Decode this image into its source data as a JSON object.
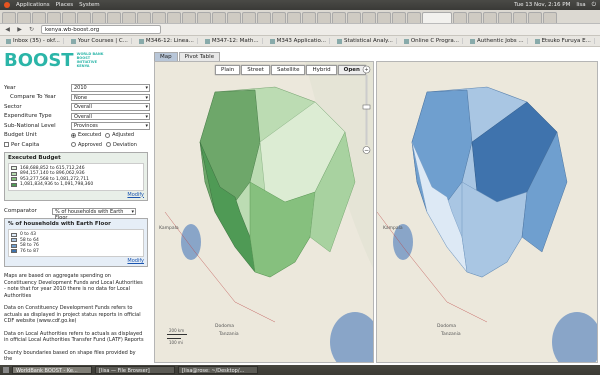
{
  "system_bar": {
    "menu": [
      "Applications",
      "Places",
      "System"
    ],
    "clock": "Tue 13 Nov, 2:16 PM",
    "user": "lisa"
  },
  "browser": {
    "url": "kenya.wb-boost.org",
    "bookmarks": [
      "Inbox (35) - okf...",
      "Your Courses | C...",
      "M346-12: Linea...",
      "M347-12: Math...",
      "M343 Applicatio...",
      "Statistical Analy...",
      "Online C Progra...",
      "Authentic Jobs ...",
      "Etsuko Furuya E..."
    ]
  },
  "logo": {
    "text": "BOOST",
    "tagline": "WORLD BANK BOOST INITIATIVE KENYA"
  },
  "filters": [
    {
      "label": "Year",
      "value": "2010"
    },
    {
      "label": "Compare To Year",
      "value": "None"
    },
    {
      "label": "Sector",
      "value": "Overall"
    },
    {
      "label": "Expenditure Type",
      "value": "Overall"
    },
    {
      "label": "Sub-National Level",
      "value": "Provinces"
    }
  ],
  "budget_unit": {
    "label": "Budget Unit",
    "options": [
      "Executed",
      "Adjusted"
    ],
    "per_capita": "Per Capita",
    "options2": [
      "Approved",
      "Deviation"
    ]
  },
  "executed_budget": {
    "title": "Executed Budget",
    "ranges": [
      "168,688,852 to 615,712,246",
      "894,157,140 to 896,062,936",
      "953,277,568 to 1,081,272,711",
      "1,081,834,936 to 1,091,798,360"
    ],
    "colors": [
      "#e4f1e0",
      "#b7dbb0",
      "#86c07e",
      "#4f9a55"
    ],
    "modify": "Modify"
  },
  "comparator": {
    "label": "Comparator",
    "value": "% of households with Earth Floor",
    "title": "% of households with Earth Floor",
    "ranges": [
      "0 to 43",
      "58 to 64",
      "58 to 76",
      "76 to 87"
    ],
    "colors": [
      "#dde9f5",
      "#a9c6e3",
      "#6f9fcf",
      "#3f73ad"
    ],
    "modify": "Modify"
  },
  "notes": [
    "Maps are based on aggregate spending on Constituency Development Funds and Local Authorities - note that for year 2010 there is no data for Local Authorities",
    "Data on Constituency Development Funds refers to actuals as displayed in project status reports in official CDF website (www.cdf.go.ke)",
    "Data on Local Authorities refers to actuals as displayed in official Local Authorities Transfer Fund (LATF) Reports",
    "County boundaries based on shape files provided by the"
  ],
  "map_tabs": [
    "Map",
    "Pivot Table"
  ],
  "map_controls": [
    "Plain",
    "Street",
    "Satellite",
    "Hybrid",
    "Open"
  ],
  "map_labels": {
    "kampala": "Kampala",
    "dodoma": "Dodoma",
    "tanzania": "Tanzania",
    "scale1": "200 km",
    "scale2": "100 mi"
  },
  "taskbar": [
    "WorldBank BOOST - Ke...",
    "[lisa — File Browser]",
    "[lisa@rose: ~/Desktop/..."
  ]
}
